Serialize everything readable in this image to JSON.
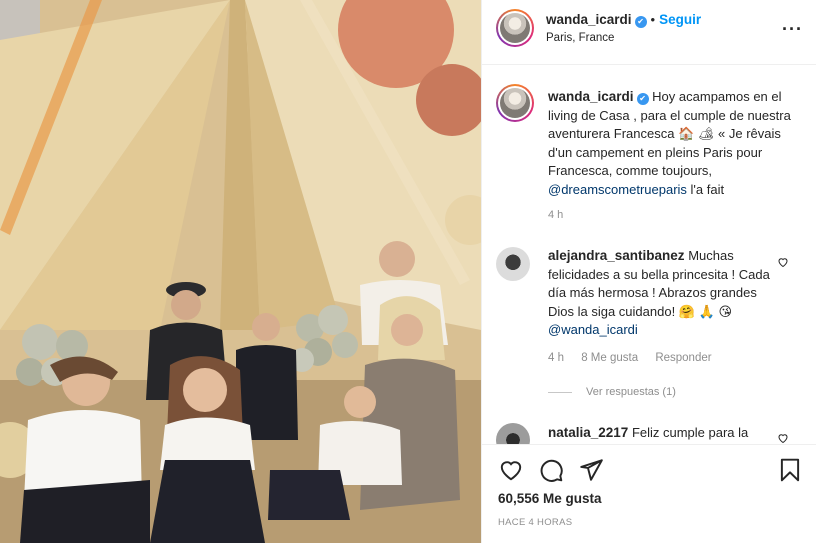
{
  "post": {
    "username": "wanda_icardi",
    "verified": true,
    "follow_label": "Seguir",
    "dot": "•",
    "location": "Paris, France",
    "more_icon": "more-options-icon"
  },
  "caption": {
    "username": "wanda_icardi",
    "text_1": "Hoy acampamos en el living de Casa , para el cumple de nuestra aventurera Francesca",
    "emoji_1": "🏠",
    "emoji_2": "🏕",
    "text_2": "« Je rêvais d'un campement en pleins Paris pour Francesca, comme toujours,",
    "mention": "@dreamscometrueparis",
    "text_3": "l'a fait",
    "time": "4 h"
  },
  "comments": [
    {
      "username": "alejandra_santibanez",
      "text": "Muchas felicidades a su bella princesita ! Cada día más hermosa ! Abrazos grandes Dios la siga cuidando!",
      "emoji_1": "🤗",
      "emoji_2": "🙏",
      "emoji_3": "😘",
      "mention": "@wanda_icardi",
      "time": "4 h",
      "likes": "8 Me gusta",
      "reply_label": "Responder",
      "view_replies": "Ver respuestas (1)"
    },
    {
      "username": "natalia_2217",
      "text": "Feliz cumple para la"
    }
  ],
  "actions": {
    "like_icon": "heart-icon",
    "comment_icon": "comment-icon",
    "share_icon": "share-icon",
    "save_icon": "bookmark-icon",
    "likes_count": "60,556 Me gusta",
    "posted_ago": "HACE 4 HORAS"
  },
  "colors": {
    "link_blue": "#0095f6",
    "mention_blue": "#00376b",
    "verified_blue": "#3897f0",
    "muted_text": "#8e8e8e"
  }
}
